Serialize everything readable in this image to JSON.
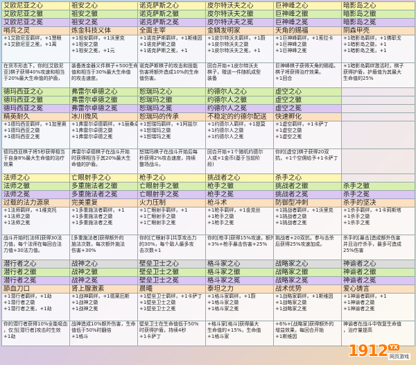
{
  "rows": [
    {
      "type": "hdr",
      "color": "yellow",
      "cells": [
        "艾欧尼亚之心",
        "祖安之心",
        "诺克萨斯之心",
        "皮尔特沃夫之心",
        "巨神峰之心",
        "暗影岛之心"
      ]
    },
    {
      "type": "hdr",
      "color": "green",
      "cells": [
        "艾欧尼亚之徽",
        "祖安之徽",
        "诺克萨斯之徽",
        "皮尔特沃夫之徽",
        "巨神峰之徽",
        "暗影岛之徽"
      ]
    },
    {
      "type": "hdr",
      "color": "purple",
      "cells": [
        "艾欧尼亚之冕",
        "祖安之冕",
        "诺克萨斯之冕",
        "皮尔特沃夫之冕",
        "巨神峰之冕",
        "暗影岛之冕"
      ]
    },
    {
      "type": "trait",
      "cells": [
        "哨兵之灵",
        "炼金科技义体",
        "全面主宰",
        "金鳞发明家",
        "天角的赐福",
        "阴森甲壳"
      ]
    },
    {
      "type": "stats",
      "cells": [
        [
          "+1艾欧尼亚羁绊，+1慧眼",
          "",
          "+1艾欧尼亚之冕，+1离"
        ],
        [
          "+1祖安羁绊，+1沃里克",
          "+1祖安之徽",
          "+1祖安之冕，+1元"
        ],
        [
          "+1诺克萨斯羁绊，+1斯维因",
          "+1诺克萨斯之徽",
          "+1诺克萨斯之冕，+1"
        ],
        [
          "+1皮尔特沃夫羁绊，+1蔚",
          "+1皮尔特沃夫之徽",
          "+1皮尔特沃夫之冕，+1"
        ],
        [
          "+1巨神峰羁绊，+1索拉卡",
          "+1巨神峰之徽",
          "+1巨神峰之冕"
        ],
        [
          "+1暗影岛羁绊，+1佛耶戈",
          "+1暗影岛之徽，+1",
          "+1暗影岛之冕，+1"
        ]
      ]
    },
    {
      "type": "desc",
      "cells": [
        [
          "在货币形态下，你的[艾欧尼",
          "亚]棋子获得40%攻速和相当",
          "于20%最大生命值的护盾，"
        ],
        [
          "装备炼金器义件棋子+500生命",
          "值和相当于30%最大生命值",
          "的攻击速度。"
        ],
        [
          "诺克萨斯棋子的攻击和技能",
          "伤害将额外造成10%的生命",
          "值伤害。"
        ],
        [
          "回合开始+1皮尔特沃夫",
          "棋子，赠送一件随机成型",
          "装备"
        ],
        [
          "巨神峰棋子获得天角的赐福，",
          "棋子将获得治疗效果。",
          "+1回合"
        ],
        [
          "+1暗影岛羁绊激活时，棋子",
          "获得护盾，护盾值为其最大",
          "生命值的25%"
        ]
      ]
    },
    {
      "type": "hdr",
      "color": "green",
      "cells": [
        "德玛西亚之心",
        "弗雷尔卓德之心",
        "恕瑞玛之心",
        "约德尔人之心",
        "虚空之心",
        ""
      ]
    },
    {
      "type": "hdr",
      "color": "green",
      "cells": [
        "德玛西亚之徽",
        "弗雷尔卓德之徽",
        "恕瑞玛之徽",
        "约德尔人之徽",
        "虚空之徽",
        ""
      ]
    },
    {
      "type": "hdr",
      "color": "purple",
      "cells": [
        "德玛西亚之冕",
        "弗雷尔卓德之冕",
        "恕瑞玛之冕",
        "约德尔人之冕",
        "虚空之冕",
        ""
      ]
    },
    {
      "type": "trait",
      "cells": [
        "精英耐久",
        "冰川微风",
        "恕瑞玛的传承",
        "不稳定的约德尔配送",
        "快速孵化",
        ""
      ]
    },
    {
      "type": "stats",
      "cells": [
        [
          "+1德玛西亚羁绊，+1加里奥",
          "+1德玛西亚之徽",
          "+1德玛西亚之冕"
        ],
        [
          "+1弗雷尔卓德羁绊，+1丽桑卓",
          "+1弗雷尔卓德之徽",
          "+1弗雷尔卓德之冕"
        ],
        [
          "+1恕瑞玛羁绊，+1阿兹尔",
          "+1恕瑞玛之徽",
          "+1恕瑞玛之冕"
        ],
        [
          "+1约德尔人羁绊，+1提莫",
          "+1约德尔人之徽",
          "+1约德尔人之冕"
        ],
        [
          "+1虚空羁绊，+1卡萨丁",
          "+1虚空之徽",
          "+1虚空之冕"
        ],
        []
      ]
    },
    {
      "type": "desc",
      "cells": [
        [
          "德玛西亚棋子将5秒获得相当",
          "于自身8%最大生命值的治疗",
          "效果"
        ],
        [
          "弗雷尔卓德棋子在战斗开始",
          "时获得相当于其20%最大生",
          "命值的护盾。"
        ],
        [
          "恕瑞玛棋子在战斗开始后每",
          "秒获得2%攻击速度，持续",
          "整场战斗。"
        ],
        [
          "回合开始+1个随机约德尔",
          "人或+1金币(基于当前阶",
          "段)"
        ],
        [
          "你的[虚空]棋子获得20双",
          "抗，+1个空佣给予+1卡萨丁",
          ""
        ],
        []
      ]
    },
    {
      "type": "hdr",
      "color": "yellow",
      "cells": [
        "法师之心",
        "亡眼射手之心",
        "枪手之心",
        "挑战者之心",
        "杀手之心",
        ""
      ]
    },
    {
      "type": "hdr",
      "color": "green",
      "cells": [
        "法师之徽",
        "多重施法者之徽",
        "亡眼射手之徽",
        "枪手之徽",
        "挑战者之徽",
        "杀手之徽"
      ]
    },
    {
      "type": "hdr",
      "color": "purple",
      "cells": [
        "法师之冕",
        "多重施法者之冕",
        "亡眼射手之冕",
        "枪手之冕",
        "挑战者之冕",
        "杀手之冕"
      ]
    },
    {
      "type": "trait",
      "cells": [
        "过载的法力源泉",
        "完美重复",
        "火力压制",
        "枪斗术",
        "防御型冲刺",
        "杀手的坚决"
      ]
    },
    {
      "type": "stats",
      "cells": [
        [
          "+1法师羁绊，+1维克托",
          "+1法师之徽",
          "+1法师之冕"
        ],
        [
          "+1多重施法者羁绊，+1",
          "+1多重施法者之徽",
          "+1多重施法者之冕"
        ],
        [
          "+1亡眼射手羁绊，+1",
          "+1亡眼射手之徽",
          "+1亡眼射手之冕"
        ],
        [
          "+1枪手羁绊，+1金克丝",
          "+1枪手之徽",
          "+1枪手之冕"
        ],
        [
          "+1挑战者羁绊，+1沃里克",
          "+1挑战者之徽",
          "+1挑战者之冕"
        ],
        [
          "+1杀手羁绊，+1卡莉斯塔",
          "+1杀手之徽",
          "+1杀手之冕"
        ]
      ]
    },
    {
      "type": "desc",
      "cells": [
        [
          "战斗开始时[法师]获得30法",
          "力值，每个法师在每回合法",
          "力值+30法力值。"
        ],
        [
          "[多重施法者]获得额外的",
          "施法次数，每次额外施法",
          "伤害+30%"
        ],
        [
          "你的[亡眼射手]共享攻击力",
          "的30%，每个敌人最多攻",
          "击次数+1"
        ],
        [
          "你的[枪手]获得15%攻速，额外",
          "+3%+枪手暴击伤害+25%",
          ""
        ],
        [
          "挑战者+20双抗，参与击杀",
          "后获得25%攻速加成。",
          ""
        ],
        [
          "杀手的[暴击]造成额外伤害",
          "并且治疗杀手，最多可造成",
          "25%伤害"
        ]
      ]
    },
    {
      "type": "hdr",
      "color": "grey",
      "cells": [
        "潜行者之心",
        "战神之心",
        "壁垒卫士之心",
        "格斗家之心",
        "战略家之心",
        "神谕者之心"
      ]
    },
    {
      "type": "hdr",
      "color": "green",
      "cells": [
        "潜行者之徽",
        "战神之徽",
        "壁垒卫士之徽",
        "格斗家之徽",
        "战略家之徽",
        "神谕者之徽"
      ]
    },
    {
      "type": "hdr",
      "color": "purple",
      "cells": [
        "潜行者之冕",
        "战神之冕",
        "壁垒卫士之冕",
        "格斗家之冕",
        "战略家之冕",
        "神谕者之冕"
      ]
    },
    {
      "type": "trait",
      "cells": [
        "舔血刀口",
        "肾上腺激素",
        "晨曦",
        "泰坦之力",
        "战术优势",
        "爱心铸言"
      ]
    },
    {
      "type": "stats",
      "cells": [
        [
          "+1潜行者羁绊，+1劫",
          "+1潜行者之徽",
          "+1潜行者之冕，+1劫"
        ],
        [
          "+1战神羁绊，+1德莱厄斯",
          "+1战神之徽",
          "+1战神之冕"
        ],
        [
          "+1壁垒卫士羁绊，+1卡萨丁",
          "+1壁垒卫士之徽",
          "+1壁垒卫士之冕"
        ],
        [
          "+1格斗家羁绊，+1蔚",
          "+1格斗家之徽",
          "+1格斗家之冕"
        ],
        [
          "+1战略家羁绊，+1斯维因",
          "+1战略家之徽",
          "+1战略家之冕"
        ],
        [
          "+1神谕者羁绊，+1",
          "+1神谕者之徽",
          "+1神谕者之冕"
        ]
      ]
    },
    {
      "type": "desc",
      "cells": [
        [
          "你的潜行者获得10%全能吸血",
          "，仅当[潜行者]攻击时生效",
          "+1劫"
        ],
        [
          "战神造成10%额外伤害，生命",
          "值低于50%时翻倍",
          "+1格斗"
        ],
        [
          "壁垒卫士在生命值低于50%",
          "时获得护盾，持续4秒",
          "+1卡萨丁"
        ],
        [
          "+格斗家[格斗]获得最大",
          "生命值的+15%，生命值",
          "+1格斗家"
        ],
        [
          "+6%+[战略家]获得额外的",
          "增益效果，每回合开始",
          "+1斯维因"
        ],
        [
          "神谕者在战斗中恢复生命值",
          "，治疗量提高",
          ""
        ]
      ]
    }
  ],
  "logo": {
    "number": "1912",
    "badge": "YX",
    "subtitle": "网页游戏"
  }
}
